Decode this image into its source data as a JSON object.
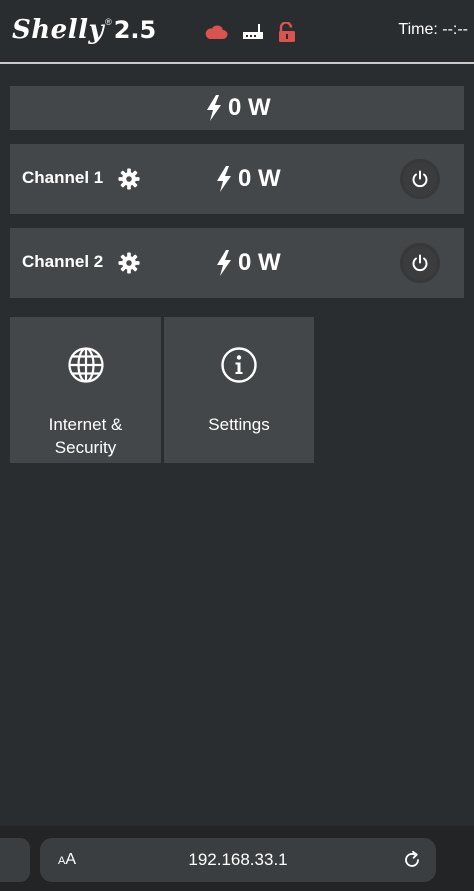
{
  "header": {
    "logo_word": "Shelly",
    "logo_reg": "®",
    "logo_model": "2.5",
    "time_label": "Time: --:--",
    "status_icons": [
      "cloud-icon",
      "router-icon",
      "unlocked-lock-icon"
    ],
    "colors": {
      "status_red": "#d9534f",
      "status_white": "#ffffff"
    }
  },
  "total": {
    "power": "0 W"
  },
  "channels": [
    {
      "name": "Channel 1",
      "power": "0 W"
    },
    {
      "name": "Channel 2",
      "power": "0 W"
    }
  ],
  "tiles": [
    {
      "label": "Internet & Security",
      "icon": "globe-icon"
    },
    {
      "label": "Settings",
      "icon": "info-icon"
    }
  ],
  "browser": {
    "text_size_label": "AA",
    "url": "192.168.33.1",
    "reload_icon": "reload-icon"
  },
  "colors": {
    "background": "#2a2d30",
    "panel": "#444749",
    "text": "#ffffff"
  }
}
